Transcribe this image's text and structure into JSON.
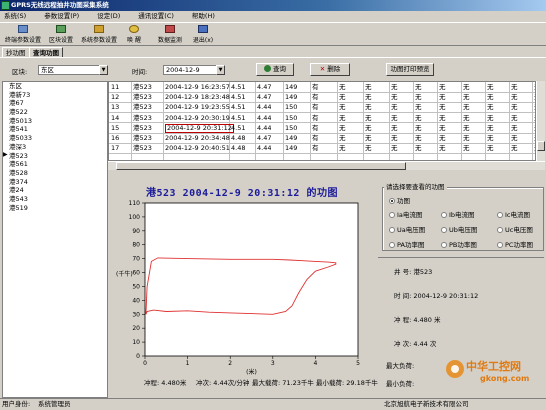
{
  "window": {
    "title": "GPRS无线远程抽井功图采集系统"
  },
  "menu": [
    "系统(S)",
    "参数设置(P)",
    "设定(D)",
    "通讯设置(C)",
    "帮助(H)"
  ],
  "toolbar": [
    {
      "label": "终端参数设置",
      "icon": "terminal-settings-icon"
    },
    {
      "label": "区块设置",
      "icon": "block-settings-icon"
    },
    {
      "label": "系统参数设置",
      "icon": "system-settings-icon"
    },
    {
      "label": "唤 醒",
      "icon": "wakeup-icon"
    },
    {
      "label": "数据监测",
      "icon": "monitor-icon"
    },
    {
      "label": "退出(x)",
      "icon": "exit-icon"
    }
  ],
  "tabs": [
    "抄功图",
    "查询功图"
  ],
  "filters": {
    "block_label": "区块:",
    "block_value": "东区",
    "time_label": "时间:",
    "time_value": "2004-12-9",
    "query_button": "查询",
    "delete_button": "删除",
    "print_button": "功图打印预览"
  },
  "wells": [
    "东区",
    "港新73",
    "港67",
    "港522",
    "港5013",
    "港541",
    "港5033",
    "港深3",
    "港523",
    "港561",
    "港528",
    "港374",
    "港24",
    "港543",
    "港519"
  ],
  "selected_well_index": 8,
  "grid_rows": [
    {
      "no": "11",
      "well": "港523",
      "time": "2004-12-9 16:23:57",
      "a": "4.51",
      "b": "4.47",
      "c": "149",
      "d": "有",
      "rest": [
        "无",
        "无",
        "无",
        "无",
        "无",
        "无",
        "无",
        "无",
        "无"
      ]
    },
    {
      "no": "12",
      "well": "港523",
      "time": "2004-12-9 18:23:48",
      "a": "4.51",
      "b": "4.47",
      "c": "149",
      "d": "有",
      "rest": [
        "无",
        "无",
        "无",
        "无",
        "无",
        "无",
        "无",
        "无",
        "无"
      ]
    },
    {
      "no": "13",
      "well": "港523",
      "time": "2004-12-9 19:23:55",
      "a": "4.51",
      "b": "4.44",
      "c": "150",
      "d": "有",
      "rest": [
        "无",
        "无",
        "无",
        "无",
        "无",
        "无",
        "无",
        "无",
        "无"
      ]
    },
    {
      "no": "14",
      "well": "港523",
      "time": "2004-12-9 20:30:19",
      "a": "4.51",
      "b": "4.44",
      "c": "150",
      "d": "有",
      "rest": [
        "无",
        "无",
        "无",
        "无",
        "无",
        "无",
        "无",
        "无",
        "无"
      ]
    },
    {
      "no": "15",
      "well": "港523",
      "time": "2004-12-9 20:31:12",
      "a": "4.51",
      "b": "4.44",
      "c": "150",
      "d": "有",
      "rest": [
        "无",
        "无",
        "无",
        "无",
        "无",
        "无",
        "无",
        "无",
        "无"
      ]
    },
    {
      "no": "16",
      "well": "港523",
      "time": "2004-12-9 20:34:48",
      "a": "4.48",
      "b": "4.47",
      "c": "149",
      "d": "有",
      "rest": [
        "无",
        "无",
        "无",
        "无",
        "无",
        "无",
        "无",
        "无",
        "无"
      ]
    },
    {
      "no": "17",
      "well": "港523",
      "time": "2004-12-9 20:40:51",
      "a": "4.48",
      "b": "4.44",
      "c": "149",
      "d": "有",
      "rest": [
        "无",
        "无",
        "无",
        "无",
        "无",
        "无",
        "无",
        "无",
        "无"
      ]
    }
  ],
  "selected_grid_row": 4,
  "chart_heading": "港523 2004-12-9 20:31:12 的功图",
  "chart_footer": {
    "stroke": "冲程: 4.480米",
    "strokes": "冲次: 4.44次/分钟",
    "max_load": "最大载荷: 71.23千牛",
    "min_load": "最小载荷: 29.18千牛"
  },
  "chart_data": {
    "type": "line",
    "title": "",
    "xlabel": "(米)",
    "ylabel": "(千牛)",
    "xlim": [
      0,
      5
    ],
    "ylim": [
      0,
      110
    ],
    "xticks": [
      "0",
      "1",
      "2",
      "3",
      "4",
      "5"
    ],
    "yticks": [
      "0",
      "10",
      "20",
      "30",
      "40",
      "50",
      "60",
      "70",
      "80",
      "90",
      "100",
      "110"
    ],
    "series": [
      {
        "color": "#e03030",
        "x": [
          0.02,
          0.05,
          0.15,
          0.3,
          1.0,
          2.0,
          3.0,
          3.4,
          3.7,
          4.0,
          4.3,
          4.48,
          4.48,
          4.3,
          4.0,
          3.8,
          3.6,
          3.45,
          3.3,
          3.0,
          2.5,
          2.0,
          1.5,
          1.0,
          0.5,
          0.2,
          0.05,
          0.02
        ],
        "y": [
          30,
          50,
          68,
          70.5,
          70,
          69.5,
          69.5,
          69,
          68.5,
          68,
          67.5,
          67,
          66,
          64,
          61,
          55,
          45,
          36,
          32,
          30,
          30.5,
          31,
          31.5,
          32.5,
          32,
          33,
          32,
          30
        ]
      }
    ]
  },
  "curve_options": {
    "title": "请选择要查看的功图",
    "options": [
      "功图",
      "Ia电流图",
      "Ib电流图",
      "Ic电流图",
      "Ua电压图",
      "Ub电压图",
      "Uc电压图",
      "PA功率图",
      "PB功率图",
      "PC功率图"
    ],
    "selected": 0
  },
  "well_info": {
    "well": "井  号:   港523",
    "time": "时  间:   2004-12-9  20:31:12",
    "stroke": "冲  程:   4.480 米",
    "strokes": "冲  次:   4.44  次",
    "max_load": "最大负荷:",
    "min_load": "最小负荷:"
  },
  "status": {
    "user_label": "用户身份:",
    "user_value": "系统管理员",
    "company": "北京旭航电子新技术有限公司"
  },
  "watermark": {
    "main": "中华工控网",
    "sub": "gkong.com"
  }
}
